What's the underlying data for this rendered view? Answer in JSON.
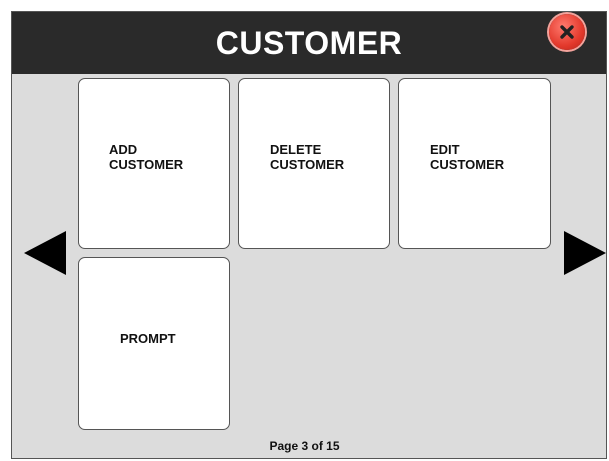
{
  "header": {
    "title": "CUSTOMER"
  },
  "close_button": {
    "icon": "close-icon",
    "color": "#e3392c"
  },
  "tiles": [
    {
      "label": "ADD\nCUSTOMER"
    },
    {
      "label": "DELETE\nCUSTOMER"
    },
    {
      "label": "EDIT\nCUSTOMER"
    },
    {
      "label": "PROMPT"
    }
  ],
  "navigation": {
    "prev_icon": "arrow-left-icon",
    "next_icon": "arrow-right-icon"
  },
  "pagination": {
    "text": "Page 3 of 15"
  }
}
